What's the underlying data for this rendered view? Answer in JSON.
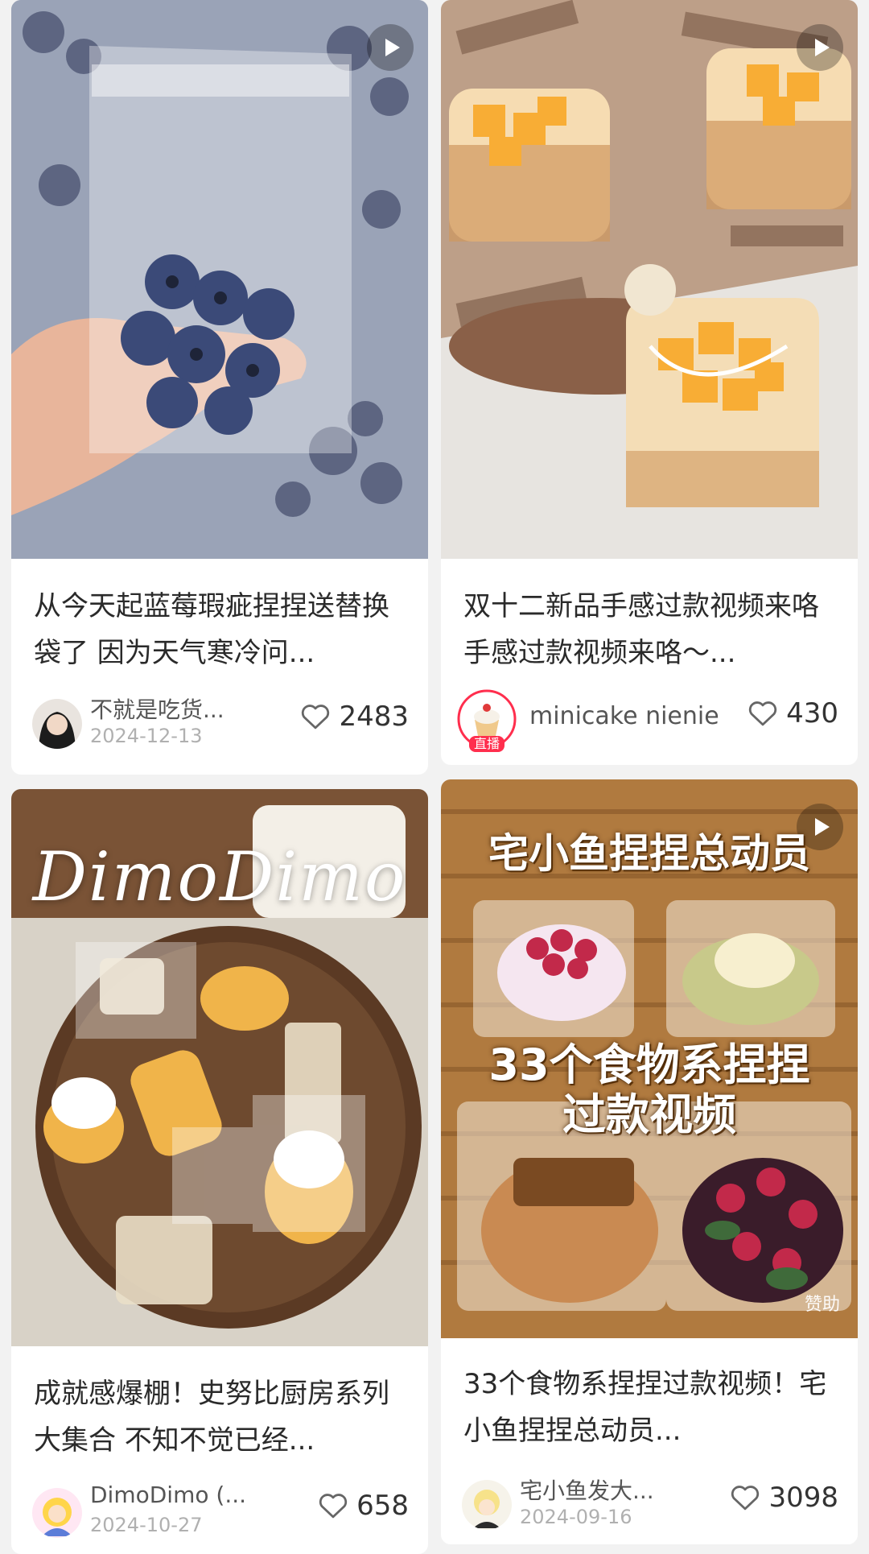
{
  "colors": {
    "background": "#f2f2f2",
    "card": "#ffffff",
    "live_badge": "#ff2e4d",
    "meta_gray": "#b0b0b0"
  },
  "posts": [
    {
      "title": "从今天起蓝莓瑕疵捏捏送替换袋了 因为天气寒冷问...",
      "author": "不就是吃货...",
      "date": "2024-12-13",
      "likes": "2483",
      "is_video": true,
      "icons": [
        "play-icon",
        "heart-icon"
      ]
    },
    {
      "title": "双十二新品手感过款视频来咯 手感过款视频来咯～...",
      "author": "minicake nienie",
      "live_label": "直播",
      "likes": "430",
      "is_video": true,
      "icons": [
        "play-icon",
        "heart-icon"
      ]
    },
    {
      "title": "成就感爆棚！史努比厨房系列大集合 不知不觉已经...",
      "author": "DimoDimo (...",
      "date": "2024-10-27",
      "likes": "658",
      "image_text": "DimoDimo",
      "is_video": false,
      "icons": [
        "heart-icon"
      ]
    },
    {
      "title": "33个食物系捏捏过款视频！宅小鱼捏捏总动员...",
      "author": "宅小鱼发大...",
      "date": "2024-09-16",
      "likes": "3098",
      "image_text_top": "宅小鱼捏捏总动员",
      "image_text_mid_1": "33个食物系捏捏",
      "image_text_mid_2": "过款视频",
      "sponsor_label": "赞助",
      "is_video": true,
      "icons": [
        "play-icon",
        "heart-icon"
      ]
    }
  ]
}
